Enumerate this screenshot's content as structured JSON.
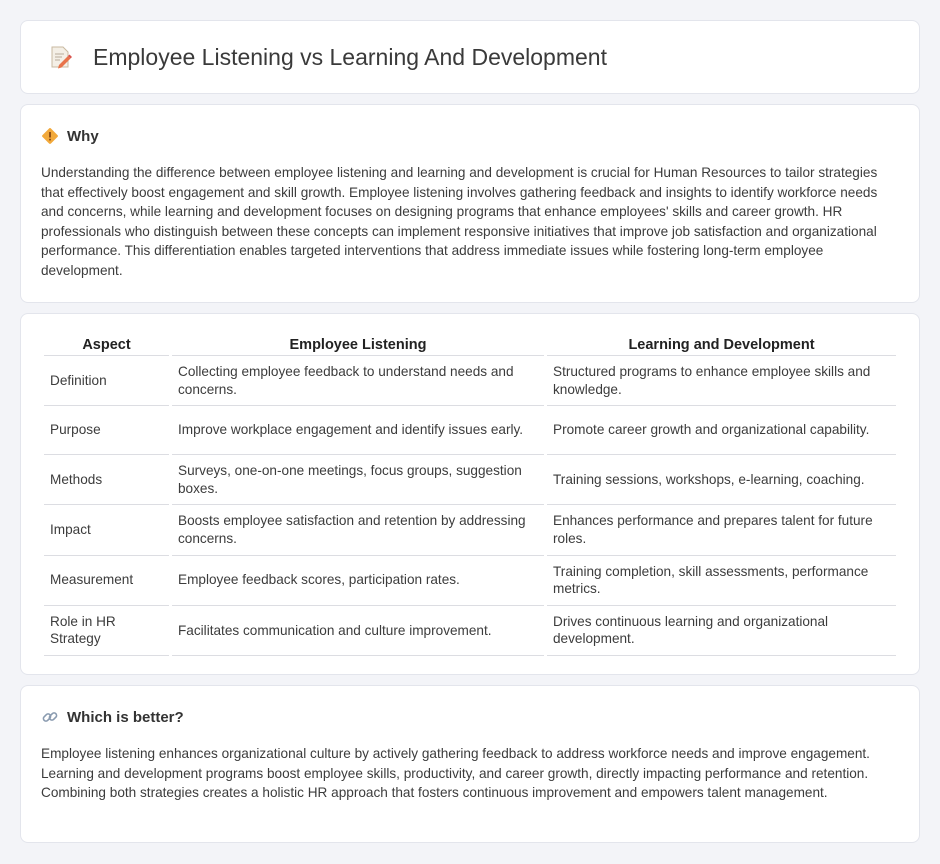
{
  "header": {
    "title": "Employee Listening vs Learning And Development",
    "icon": "document-pencil-icon"
  },
  "why": {
    "title": "Why",
    "icon": "diamond-warning-icon",
    "text": "Understanding the difference between employee listening and learning and development is crucial for Human Resources to tailor strategies that effectively boost engagement and skill growth. Employee listening involves gathering feedback and insights to identify workforce needs and concerns, while learning and development focuses on designing programs that enhance employees' skills and career growth. HR professionals who distinguish between these concepts can implement responsive initiatives that improve job satisfaction and organizational performance. This differentiation enables targeted interventions that address immediate issues while fostering long-term employee development."
  },
  "table": {
    "headers": [
      "Aspect",
      "Employee Listening",
      "Learning and Development"
    ],
    "rows": [
      [
        "Definition",
        "Collecting employee feedback to understand needs and concerns.",
        "Structured programs to enhance employee skills and knowledge."
      ],
      [
        "Purpose",
        "Improve workplace engagement and identify issues early.",
        "Promote career growth and organizational capability."
      ],
      [
        "Methods",
        "Surveys, one-on-one meetings, focus groups, suggestion boxes.",
        "Training sessions, workshops, e-learning, coaching."
      ],
      [
        "Impact",
        "Boosts employee satisfaction and retention by addressing concerns.",
        "Enhances performance and prepares talent for future roles."
      ],
      [
        "Measurement",
        "Employee feedback scores, participation rates.",
        "Training completion, skill assessments, performance metrics."
      ],
      [
        "Role in HR Strategy",
        "Facilitates communication and culture improvement.",
        "Drives continuous learning and organizational development."
      ]
    ]
  },
  "better": {
    "title": "Which is better?",
    "icon": "link-icon",
    "text": "Employee listening enhances organizational culture by actively gathering feedback to address workforce needs and improve engagement. Learning and development programs boost employee skills, productivity, and career growth, directly impacting performance and retention. Combining both strategies creates a holistic HR approach that fosters continuous improvement and empowers talent management."
  }
}
